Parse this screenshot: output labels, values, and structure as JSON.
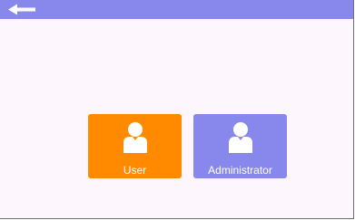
{
  "topbar": {
    "color": "#8787ec",
    "back_icon": "arrow-left-icon"
  },
  "roles": [
    {
      "label": "User",
      "icon": "user-icon",
      "color": "#ff8a00"
    },
    {
      "label": "Administrator",
      "icon": "user-icon",
      "color": "#8787ec"
    }
  ]
}
